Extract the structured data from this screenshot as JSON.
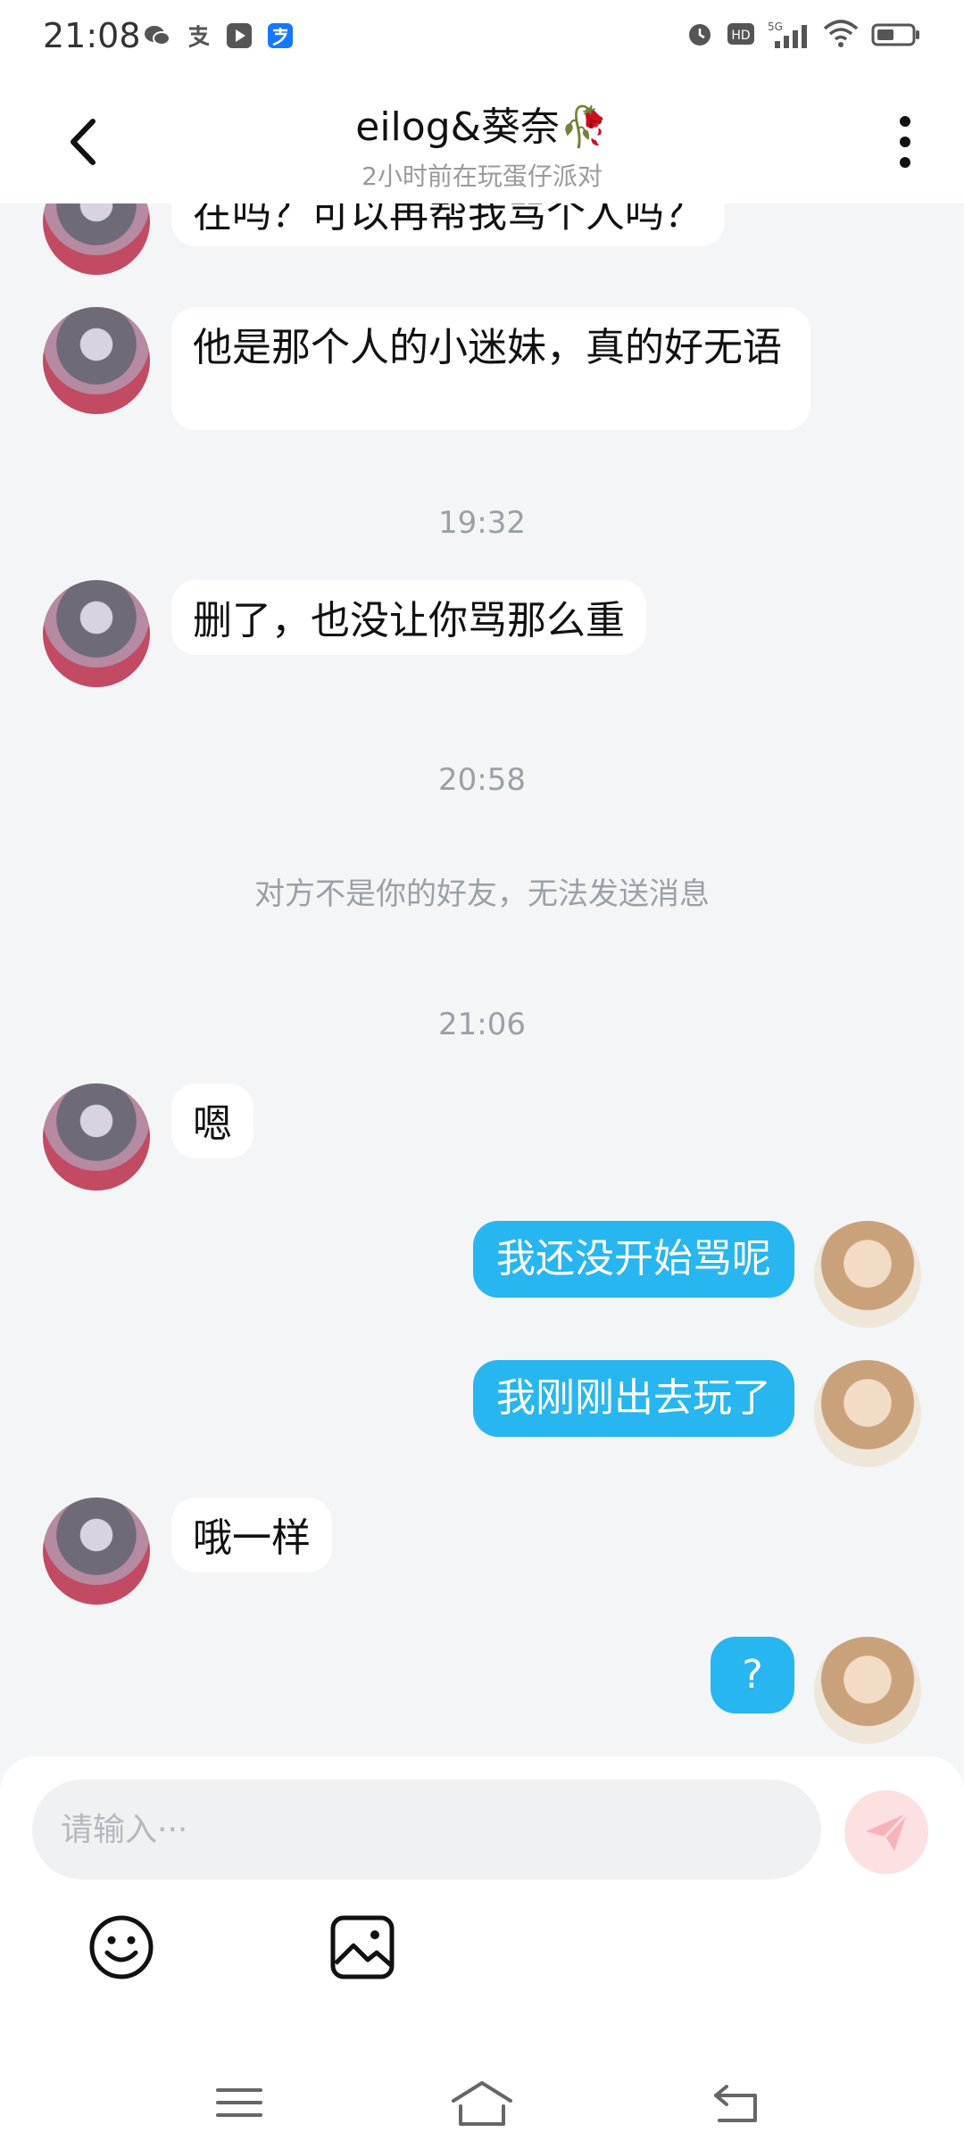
{
  "status_bar": {
    "time": "21:08",
    "app_icons": [
      "wechat-icon",
      "alipay-icon",
      "video-play-icon",
      "alipay-app-icon"
    ],
    "network": "5G",
    "hd_label": "HD"
  },
  "header": {
    "title": "eilog&葵奈🥀",
    "subtitle": "2小时前在玩蛋仔派对"
  },
  "messages": [
    {
      "side": "left",
      "text": "在吗？可以再帮我骂个人吗？"
    },
    {
      "side": "left",
      "text": "他是那个人的小迷妹，真的好无语"
    },
    {
      "type": "time",
      "text": "19:32"
    },
    {
      "side": "left",
      "text": "删了，也没让你骂那么重"
    },
    {
      "type": "time",
      "text": "20:58"
    },
    {
      "type": "notice",
      "text": "对方不是你的好友，无法发送消息"
    },
    {
      "type": "time",
      "text": "21:06"
    },
    {
      "side": "left",
      "text": "嗯"
    },
    {
      "side": "right",
      "text": "我还没开始骂呢"
    },
    {
      "side": "right",
      "text": "我刚刚出去玩了"
    },
    {
      "side": "left",
      "text": "哦一样"
    },
    {
      "side": "right",
      "text": "?"
    }
  ],
  "input": {
    "placeholder": "请输入···",
    "value": ""
  },
  "colors": {
    "accent_blue": "#27b6ef",
    "send_button_bg": "#fde0e2",
    "send_icon": "#f8b3b8",
    "background": "#f4f5f7"
  },
  "icons": {
    "back": "chevron-left-icon",
    "more": "more-vertical-icon",
    "send": "paper-plane-icon",
    "emoji": "smiley-icon",
    "image": "image-icon",
    "nav_menu": "menu-icon",
    "nav_home": "home-icon",
    "nav_back": "back-icon"
  }
}
